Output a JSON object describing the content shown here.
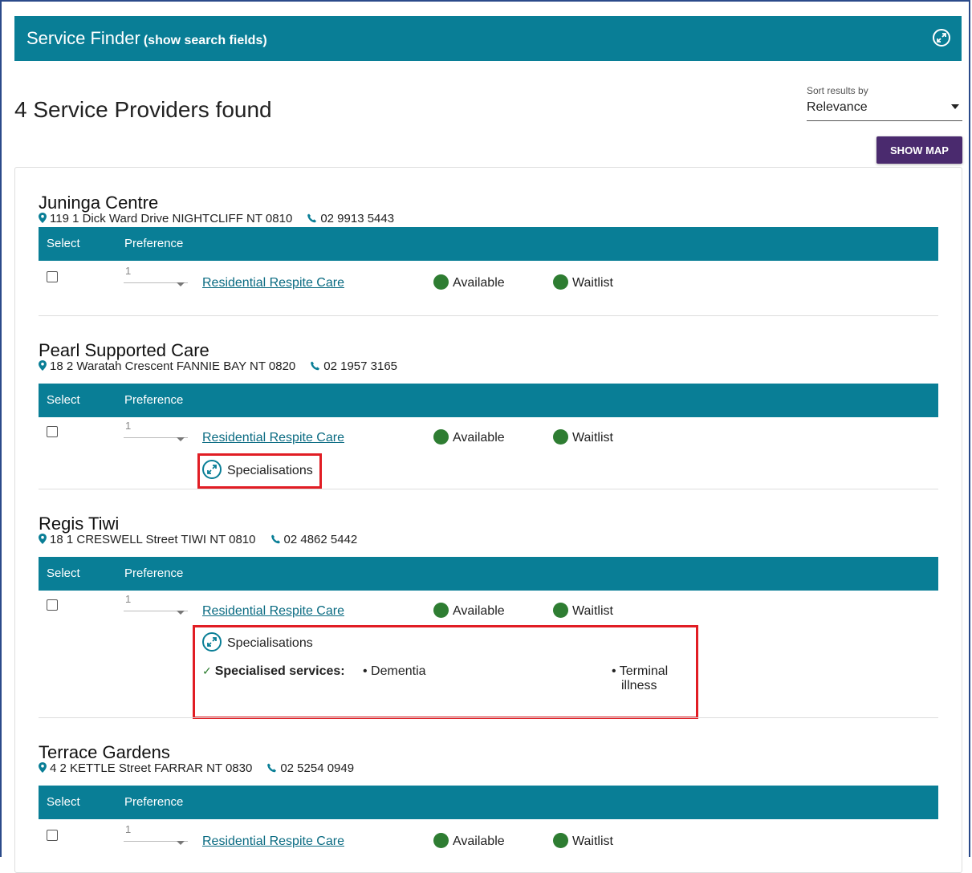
{
  "header": {
    "title": "Service Finder",
    "toggle_link": "(show search fields)",
    "expand_icon": "expand-icon"
  },
  "results": {
    "count_text": "4 Service Providers found",
    "sort_label": "Sort results by",
    "sort_value": "Relevance",
    "show_map_label": "SHOW MAP"
  },
  "table_headers": {
    "select": "Select",
    "preference": "Preference"
  },
  "providers": [
    {
      "name": "Juninga Centre",
      "address": "119 1 Dick Ward Drive NIGHTCLIFF NT 0810",
      "phone": "02 9913 5443",
      "preference": "1",
      "service": "Residential Respite Care",
      "status1": "Available",
      "status2": "Waitlist"
    },
    {
      "name": "Pearl Supported Care",
      "address": "18 2 Waratah Crescent FANNIE BAY NT 0820",
      "phone": "02 1957 3165",
      "preference": "1",
      "service": "Residential Respite Care",
      "status1": "Available",
      "status2": "Waitlist",
      "specialisations_label": "Specialisations"
    },
    {
      "name": "Regis Tiwi",
      "address": "18 1 CRESWELL Street TIWI NT 0810",
      "phone": "02 4862 5442",
      "preference": "1",
      "service": "Residential Respite Care",
      "status1": "Available",
      "status2": "Waitlist",
      "specialisations_label": "Specialisations",
      "specialised_services_label": "Specialised services:",
      "specialisations": [
        "Dementia",
        "Terminal",
        "illness"
      ]
    },
    {
      "name": "Terrace Gardens",
      "address": "4 2 KETTLE Street FARRAR NT 0830",
      "phone": "02 5254 0949",
      "preference": "1",
      "service": "Residential Respite Care",
      "status1": "Available",
      "status2": "Waitlist"
    }
  ],
  "colors": {
    "teal": "#097e96",
    "purple_button": "#4a2a6e",
    "status_green": "#2e7d32",
    "highlight_red": "#e11d24"
  }
}
